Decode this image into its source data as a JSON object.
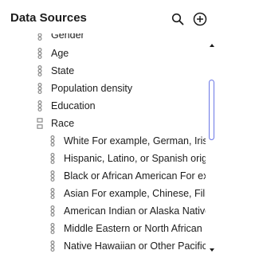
{
  "panel": {
    "title": "Data Sources",
    "search_icon": "search-icon",
    "add_icon": "add-circle-icon"
  },
  "fields": [
    {
      "label": "Gender",
      "icon": "drag-handle-icon"
    },
    {
      "label": "Age",
      "icon": "drag-handle-icon"
    },
    {
      "label": "State",
      "icon": "drag-handle-icon"
    },
    {
      "label": "Population density",
      "icon": "drag-handle-icon"
    },
    {
      "label": "Education",
      "icon": "drag-handle-icon"
    },
    {
      "label": "Race",
      "icon": "group-icon"
    }
  ],
  "race_options": [
    {
      "label": "White For example, German, Irish, English, Italian, Lebanese, Egyptian, etc."
    },
    {
      "label": "Hispanic, Latino, or Spanish origin For example, Mexican, Puerto Rican, Cuban, etc."
    },
    {
      "label": "Black or African American For example, Jamaican, Haitian, Nigerian, etc."
    },
    {
      "label": "Asian For example, Chinese, Filipino, Asian Indian, Vietnamese, etc."
    },
    {
      "label": "American Indian or Alaska Native For example, Navajo Nation, etc."
    },
    {
      "label": "Middle Eastern or North African For example, Lebanese, Iranian, etc."
    },
    {
      "label": "Native Hawaiian or Other Pacific Islander For example, Samoan, etc."
    }
  ],
  "colors": {
    "text": "#1c1c1c",
    "icon": "#8a8a8a",
    "scrollbar": "#6b77e6"
  }
}
